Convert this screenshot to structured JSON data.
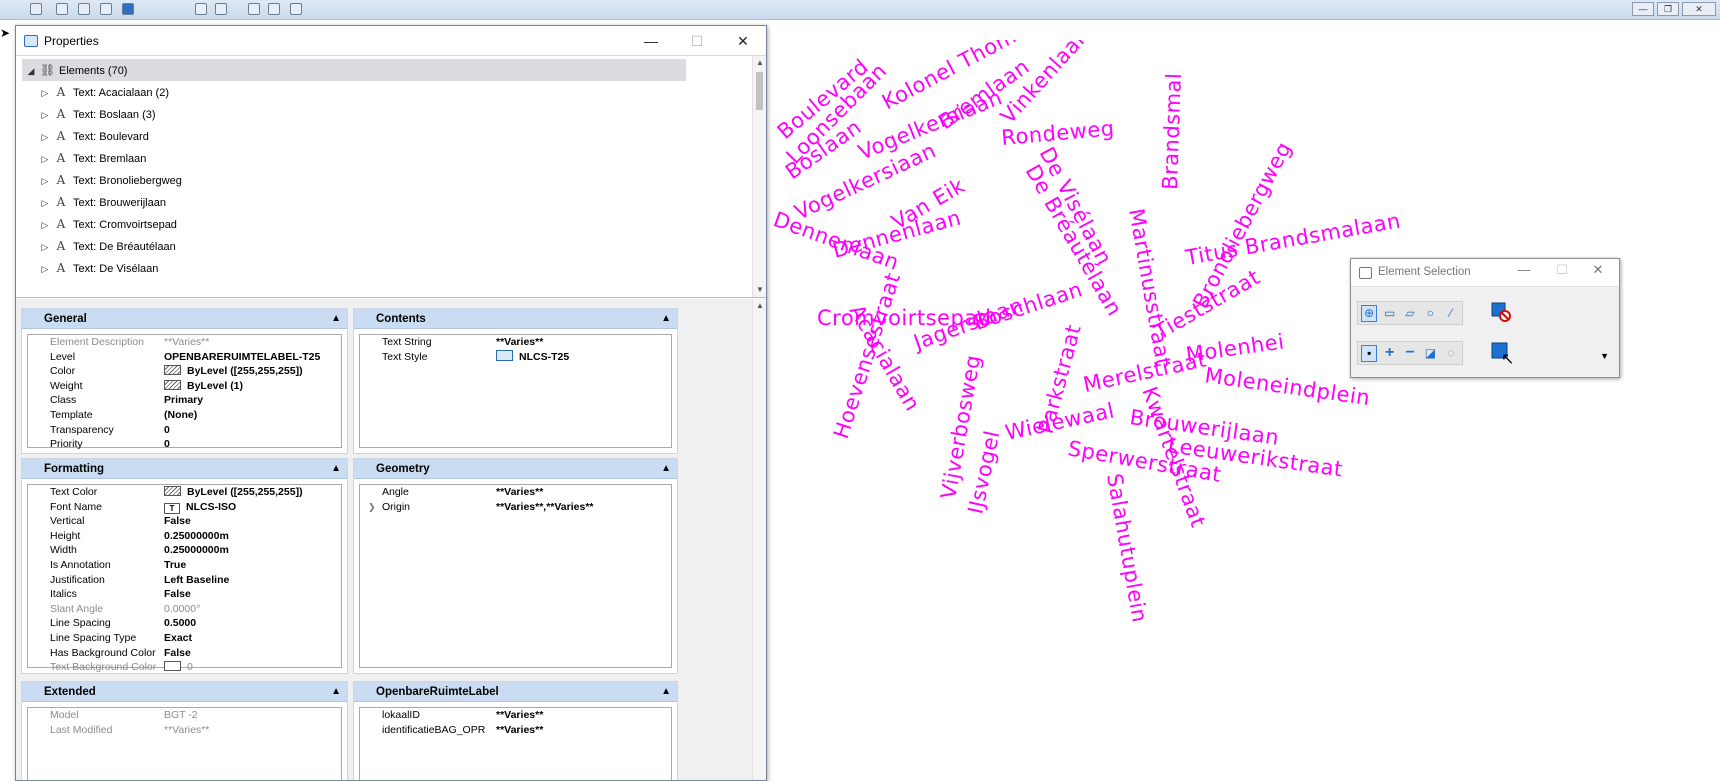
{
  "colors": {
    "label_magenta": "#ff00ff",
    "section_header": "#c9dcf2",
    "tree_selected": "#dcdce0"
  },
  "properties_window": {
    "title": "Properties",
    "controls": [
      "minimize-icon",
      "maximize-icon",
      "close-icon"
    ],
    "tree": {
      "root_label": "Elements (70)",
      "items": [
        "Text: Acacialaan (2)",
        "Text: Boslaan (3)",
        "Text: Boulevard",
        "Text: Bremlaan",
        "Text: Bronoliebergweg",
        "Text: Brouwerijlaan",
        "Text: Cromvoirtsepad",
        "Text: De Bréautélaan",
        "Text: De Visélaan"
      ]
    },
    "sections": {
      "general": {
        "title": "General",
        "rows": [
          {
            "label": "Element Description",
            "value": "**Varies**",
            "dim": true
          },
          {
            "label": "Level",
            "value": "OPENBARERUIMTELABEL-T25"
          },
          {
            "label": "Color",
            "value": "ByLevel ([255,255,255])",
            "icon": "color-swatch-icon"
          },
          {
            "label": "Weight",
            "value": "ByLevel (1)",
            "icon": "weight-swatch-icon"
          },
          {
            "label": "Class",
            "value": "Primary"
          },
          {
            "label": "Template",
            "value": "(None)"
          },
          {
            "label": "Transparency",
            "value": "0"
          },
          {
            "label": "Priority",
            "value": "0"
          }
        ]
      },
      "contents": {
        "title": "Contents",
        "rows": [
          {
            "label": "Text String",
            "value": "**Varies**"
          },
          {
            "label": "Text Style",
            "value": "NLCS-T25",
            "icon": "text-style-icon"
          }
        ]
      },
      "formatting": {
        "title": "Formatting",
        "rows": [
          {
            "label": "Text Color",
            "value": "ByLevel ([255,255,255])",
            "icon": "color-swatch-icon"
          },
          {
            "label": "Font Name",
            "value": "NLCS-ISO",
            "icon": "font-icon"
          },
          {
            "label": "Vertical",
            "value": "False"
          },
          {
            "label": "Height",
            "value": "0.25000000m"
          },
          {
            "label": "Width",
            "value": "0.25000000m"
          },
          {
            "label": "Is Annotation",
            "value": "True"
          },
          {
            "label": "Justification",
            "value": "Left Baseline"
          },
          {
            "label": "Italics",
            "value": "False"
          },
          {
            "label": "Slant Angle",
            "value": "0.0000°",
            "dim": true
          },
          {
            "label": "Line Spacing",
            "value": "0.5000"
          },
          {
            "label": "Line Spacing Type",
            "value": "Exact"
          },
          {
            "label": "Has Background Color",
            "value": "False"
          },
          {
            "label": "Text Background Color",
            "value": "0",
            "dim": true,
            "icon": "blank-swatch-icon"
          }
        ]
      },
      "geometry": {
        "title": "Geometry",
        "rows": [
          {
            "label": "Angle",
            "value": "**Varies**"
          },
          {
            "label": "Origin",
            "value": "**Varies**,**Varies**",
            "expandable": true
          }
        ]
      },
      "extended": {
        "title": "Extended",
        "rows": [
          {
            "label": "Model",
            "value": "BGT -2",
            "dim": true
          },
          {
            "label": "Last Modified",
            "value": "**Varies**",
            "dim": true
          }
        ]
      },
      "openbareruimtelabel": {
        "title": "OpenbareRuimteLabel",
        "rows": [
          {
            "label": "lokaalID",
            "value": "**Varies**"
          },
          {
            "label": "identificatieBAG_OPR",
            "value": "**Varies**"
          }
        ]
      }
    }
  },
  "element_selection": {
    "title": "Element Selection",
    "controls": [
      "minimize-icon",
      "maximize-icon",
      "close-icon"
    ],
    "row1_tools": [
      "individual-select-icon",
      "block-select-icon",
      "shape-select-icon",
      "circle-select-icon",
      "line-select-icon"
    ],
    "row2_tools": [
      "new-selection-icon",
      "add-selection-icon",
      "subtract-selection-icon",
      "invert-selection-icon",
      "clear-selection-icon"
    ],
    "right_tools": [
      "clear-selection-set-icon",
      "select-all-icon"
    ],
    "more_arrow": "▼"
  },
  "street_labels": [
    "Boulevard",
    "Boslaan",
    "Loonsebaan",
    "Vogelkersiaan",
    "Kolonel Thom",
    "Vogelkersiaan",
    "Bremlaan",
    "Vinkenlaan",
    "Rondeweg",
    "Brandsmal",
    "Van Eik",
    "Dennenlaan",
    "Dennenlaan",
    "Boschlaan",
    "Cromvoirtsepad",
    "Acacialaan",
    "Hoevensestraat",
    "De Bréautélaan",
    "De Visélaan",
    "Titus Brandsmalaan",
    "Bronoliebergweg",
    "Vijverbosweg",
    "IJsvogel",
    "Molenhei",
    "Moleneindplein",
    "Salahutuplein",
    "Leeuwerikstraat",
    "Martinusstraat",
    "Merelstraat",
    "Parkstraat",
    "Wielewaal",
    "Brouwerijlaan",
    "Sperwerstraat",
    "Tieststraat",
    "Kwartelstraat",
    "Jagerslaan"
  ]
}
